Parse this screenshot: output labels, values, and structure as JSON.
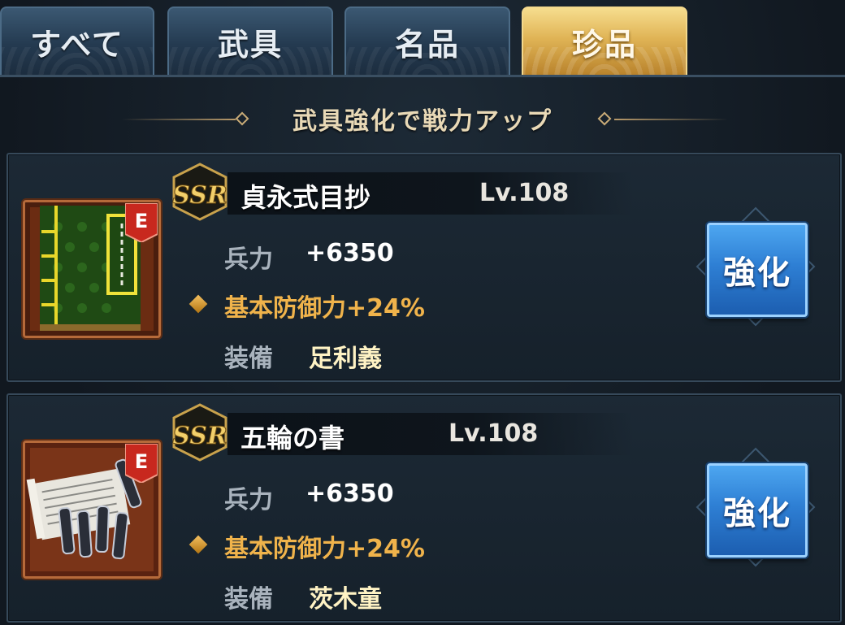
{
  "tabs": [
    {
      "label": "すべて",
      "active": false
    },
    {
      "label": "武具",
      "active": false
    },
    {
      "label": "名品",
      "active": false
    },
    {
      "label": "珍品",
      "active": true
    }
  ],
  "banner": {
    "text": "武具強化で戦力アップ"
  },
  "items": [
    {
      "rarity": "SSR",
      "name": "貞永式目抄",
      "level": "Lv.108",
      "equipped_badge": "E",
      "power_label": "兵力",
      "power_value": "+6350",
      "bonus": "基本防御力+24%",
      "equip_label": "装備",
      "equip_value": "足利義",
      "button_label": "強化",
      "icon": "book-icon"
    },
    {
      "rarity": "SSR",
      "name": "五輪の書",
      "level": "Lv.108",
      "equipped_badge": "E",
      "power_label": "兵力",
      "power_value": "+6350",
      "bonus": "基本防御力+24%",
      "equip_label": "装備",
      "equip_value": "茨木童",
      "button_label": "強化",
      "icon": "scrolls-icon"
    }
  ],
  "colors": {
    "tab_active": "#e0b456",
    "tab_inactive": "#243a50",
    "bonus_text": "#f0b34b",
    "button_blue": "#2e7fd4"
  }
}
